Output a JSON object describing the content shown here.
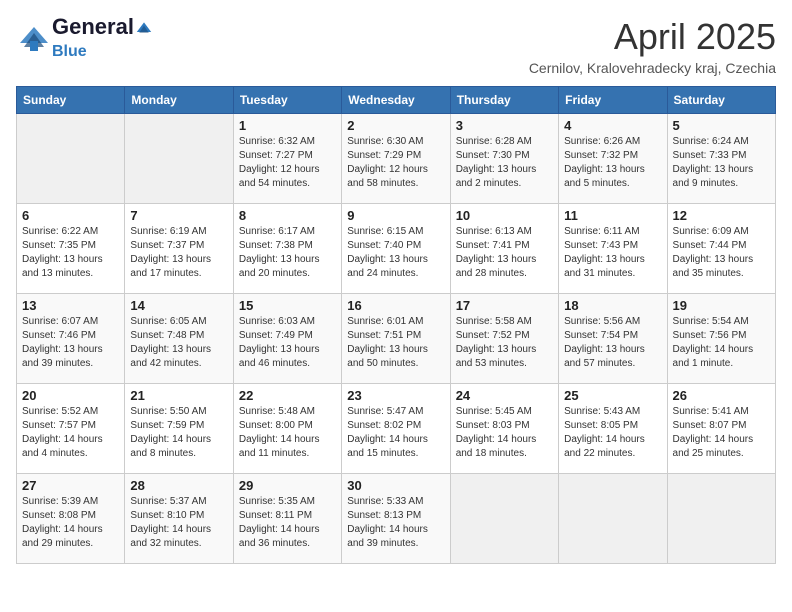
{
  "header": {
    "logo_line1": "General",
    "logo_line2": "Blue",
    "month_title": "April 2025",
    "location": "Cernilov, Kralovehradecky kraj, Czechia"
  },
  "days_of_week": [
    "Sunday",
    "Monday",
    "Tuesday",
    "Wednesday",
    "Thursday",
    "Friday",
    "Saturday"
  ],
  "weeks": [
    [
      {
        "day": "",
        "info": ""
      },
      {
        "day": "",
        "info": ""
      },
      {
        "day": "1",
        "info": "Sunrise: 6:32 AM\nSunset: 7:27 PM\nDaylight: 12 hours and 54 minutes."
      },
      {
        "day": "2",
        "info": "Sunrise: 6:30 AM\nSunset: 7:29 PM\nDaylight: 12 hours and 58 minutes."
      },
      {
        "day": "3",
        "info": "Sunrise: 6:28 AM\nSunset: 7:30 PM\nDaylight: 13 hours and 2 minutes."
      },
      {
        "day": "4",
        "info": "Sunrise: 6:26 AM\nSunset: 7:32 PM\nDaylight: 13 hours and 5 minutes."
      },
      {
        "day": "5",
        "info": "Sunrise: 6:24 AM\nSunset: 7:33 PM\nDaylight: 13 hours and 9 minutes."
      }
    ],
    [
      {
        "day": "6",
        "info": "Sunrise: 6:22 AM\nSunset: 7:35 PM\nDaylight: 13 hours and 13 minutes."
      },
      {
        "day": "7",
        "info": "Sunrise: 6:19 AM\nSunset: 7:37 PM\nDaylight: 13 hours and 17 minutes."
      },
      {
        "day": "8",
        "info": "Sunrise: 6:17 AM\nSunset: 7:38 PM\nDaylight: 13 hours and 20 minutes."
      },
      {
        "day": "9",
        "info": "Sunrise: 6:15 AM\nSunset: 7:40 PM\nDaylight: 13 hours and 24 minutes."
      },
      {
        "day": "10",
        "info": "Sunrise: 6:13 AM\nSunset: 7:41 PM\nDaylight: 13 hours and 28 minutes."
      },
      {
        "day": "11",
        "info": "Sunrise: 6:11 AM\nSunset: 7:43 PM\nDaylight: 13 hours and 31 minutes."
      },
      {
        "day": "12",
        "info": "Sunrise: 6:09 AM\nSunset: 7:44 PM\nDaylight: 13 hours and 35 minutes."
      }
    ],
    [
      {
        "day": "13",
        "info": "Sunrise: 6:07 AM\nSunset: 7:46 PM\nDaylight: 13 hours and 39 minutes."
      },
      {
        "day": "14",
        "info": "Sunrise: 6:05 AM\nSunset: 7:48 PM\nDaylight: 13 hours and 42 minutes."
      },
      {
        "day": "15",
        "info": "Sunrise: 6:03 AM\nSunset: 7:49 PM\nDaylight: 13 hours and 46 minutes."
      },
      {
        "day": "16",
        "info": "Sunrise: 6:01 AM\nSunset: 7:51 PM\nDaylight: 13 hours and 50 minutes."
      },
      {
        "day": "17",
        "info": "Sunrise: 5:58 AM\nSunset: 7:52 PM\nDaylight: 13 hours and 53 minutes."
      },
      {
        "day": "18",
        "info": "Sunrise: 5:56 AM\nSunset: 7:54 PM\nDaylight: 13 hours and 57 minutes."
      },
      {
        "day": "19",
        "info": "Sunrise: 5:54 AM\nSunset: 7:56 PM\nDaylight: 14 hours and 1 minute."
      }
    ],
    [
      {
        "day": "20",
        "info": "Sunrise: 5:52 AM\nSunset: 7:57 PM\nDaylight: 14 hours and 4 minutes."
      },
      {
        "day": "21",
        "info": "Sunrise: 5:50 AM\nSunset: 7:59 PM\nDaylight: 14 hours and 8 minutes."
      },
      {
        "day": "22",
        "info": "Sunrise: 5:48 AM\nSunset: 8:00 PM\nDaylight: 14 hours and 11 minutes."
      },
      {
        "day": "23",
        "info": "Sunrise: 5:47 AM\nSunset: 8:02 PM\nDaylight: 14 hours and 15 minutes."
      },
      {
        "day": "24",
        "info": "Sunrise: 5:45 AM\nSunset: 8:03 PM\nDaylight: 14 hours and 18 minutes."
      },
      {
        "day": "25",
        "info": "Sunrise: 5:43 AM\nSunset: 8:05 PM\nDaylight: 14 hours and 22 minutes."
      },
      {
        "day": "26",
        "info": "Sunrise: 5:41 AM\nSunset: 8:07 PM\nDaylight: 14 hours and 25 minutes."
      }
    ],
    [
      {
        "day": "27",
        "info": "Sunrise: 5:39 AM\nSunset: 8:08 PM\nDaylight: 14 hours and 29 minutes."
      },
      {
        "day": "28",
        "info": "Sunrise: 5:37 AM\nSunset: 8:10 PM\nDaylight: 14 hours and 32 minutes."
      },
      {
        "day": "29",
        "info": "Sunrise: 5:35 AM\nSunset: 8:11 PM\nDaylight: 14 hours and 36 minutes."
      },
      {
        "day": "30",
        "info": "Sunrise: 5:33 AM\nSunset: 8:13 PM\nDaylight: 14 hours and 39 minutes."
      },
      {
        "day": "",
        "info": ""
      },
      {
        "day": "",
        "info": ""
      },
      {
        "day": "",
        "info": ""
      }
    ]
  ]
}
